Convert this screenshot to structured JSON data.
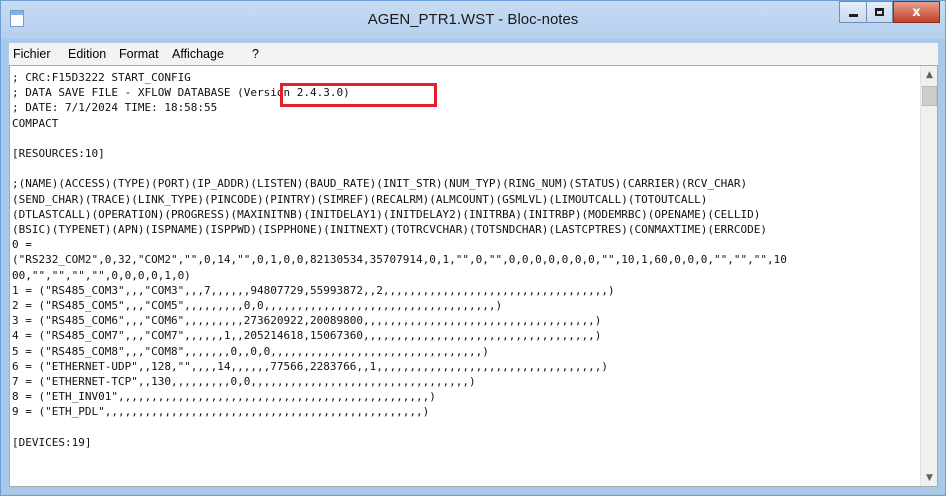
{
  "window": {
    "title": "AGEN_PTR1.WST - Bloc-notes",
    "controls": {
      "minimize": "minimize",
      "maximize": "maximize",
      "close_label": "x"
    }
  },
  "menu": {
    "items": [
      "Fichier",
      "Edition",
      "Format",
      "Affichage",
      "?"
    ]
  },
  "editor": {
    "lines": [
      "; CRC:F15D3222 START_CONFIG",
      "; DATA SAVE FILE - XFLOW DATABASE (Version 2.4.3.0)",
      "; DATE: 7/1/2024 TIME: 18:58:55",
      "COMPACT",
      "",
      "[RESOURCES:10]",
      "",
      ";(NAME)(ACCESS)(TYPE)(PORT)(IP_ADDR)(LISTEN)(BAUD_RATE)(INIT_STR)(NUM_TYP)(RING_NUM)(STATUS)(CARRIER)(RCV_CHAR)",
      "(SEND_CHAR)(TRACE)(LINK_TYPE)(PINCODE)(PINTRY)(SIMREF)(RECALRM)(ALMCOUNT)(GSMLVL)(LIMOUTCALL)(TOTOUTCALL)",
      "(DTLASTCALL)(OPERATION)(PROGRESS)(MAXINITNB)(INITDELAY1)(INITDELAY2)(INITRBA)(INITRBP)(MODEMRBC)(OPENAME)(CELLID)",
      "(BSIC)(TYPENET)(APN)(ISPNAME)(ISPPWD)(ISPPHONE)(INITNEXT)(TOTRCVCHAR)(TOTSNDCHAR)(LASTCPTRES)(CONMAXTIME)(ERRCODE)",
      "0 =",
      "(\"RS232_COM2\",0,32,\"COM2\",\"\",0,14,\"\",0,1,0,0,82130534,35707914,0,1,\"\",0,\"\",0,0,0,0,0,0,0,\"\",10,1,60,0,0,0,\"\",\"\",\"\",10",
      "00,\"\",\"\",\"\",\"\",0,0,0,0,1,0)",
      "1 = (\"RS485_COM3\",,,\"COM3\",,,7,,,,,,94807729,55993872,,2,,,,,,,,,,,,,,,,,,,,,,,,,,,,,,,,,,)",
      "2 = (\"RS485_COM5\",,,\"COM5\",,,,,,,,,0,0,,,,,,,,,,,,,,,,,,,,,,,,,,,,,,,,,,,)",
      "3 = (\"RS485_COM6\",,,\"COM6\",,,,,,,,,273620922,20089800,,,,,,,,,,,,,,,,,,,,,,,,,,,,,,,,,,,)",
      "4 = (\"RS485_COM7\",,,\"COM7\",,,,,,1,,205214618,15067360,,,,,,,,,,,,,,,,,,,,,,,,,,,,,,,,,,,)",
      "5 = (\"RS485_COM8\",,,\"COM8\",,,,,,,0,,0,0,,,,,,,,,,,,,,,,,,,,,,,,,,,,,,,,)",
      "6 = (\"ETHERNET-UDP\",,128,\"\",,,,14,,,,,,77566,2283766,,1,,,,,,,,,,,,,,,,,,,,,,,,,,,,,,,,,,)",
      "7 = (\"ETHERNET-TCP\",,130,,,,,,,,,0,0,,,,,,,,,,,,,,,,,,,,,,,,,,,,,,,,,)",
      "8 = (\"ETH_INV01\",,,,,,,,,,,,,,,,,,,,,,,,,,,,,,,,,,,,,,,,,,,,,,,)",
      "9 = (\"ETH_PDL\",,,,,,,,,,,,,,,,,,,,,,,,,,,,,,,,,,,,,,,,,,,,,,,,)",
      "",
      "[DEVICES:19]"
    ]
  },
  "scrollbar": {
    "up_label": "^",
    "down_label": "v"
  },
  "highlight": {
    "color": "#e0202a"
  }
}
